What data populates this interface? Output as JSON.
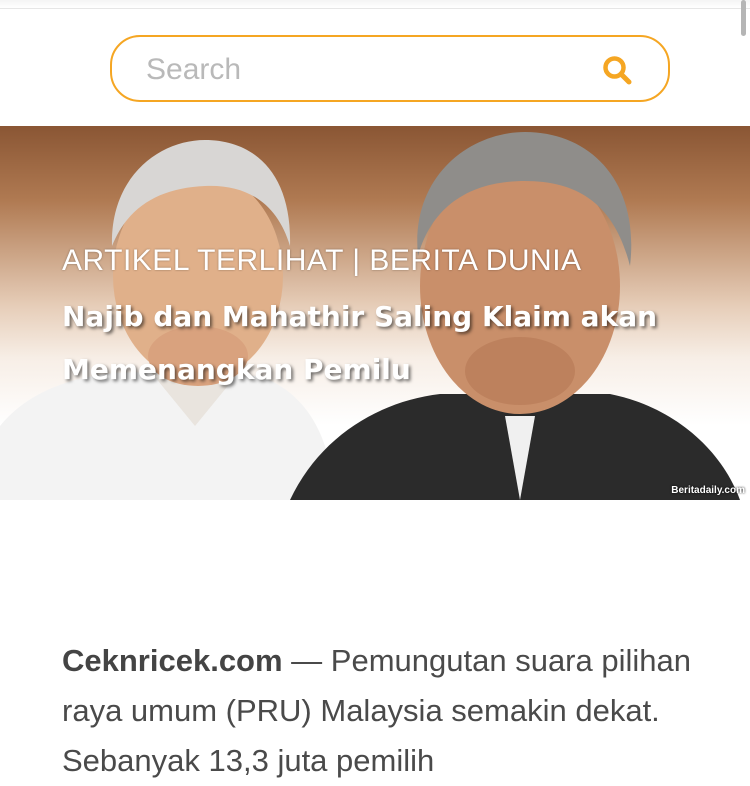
{
  "search": {
    "placeholder": "Search",
    "value": "",
    "icon": "search-icon",
    "accent_color": "#f5a623"
  },
  "featured": {
    "category": "ARTIKEL TERLIHAT | BERITA DUNIA",
    "headline": "Najib dan Mahathir Saling Klaim akan Memenangkan Pemilu",
    "image_credit": "Beritadaily.com"
  },
  "article": {
    "source": "Ceknricek.com",
    "lead": " — Pemungutan suara pilihan raya umum (PRU) Malaysia semakin dekat. Sebanyak 13,3 juta pemilih"
  }
}
